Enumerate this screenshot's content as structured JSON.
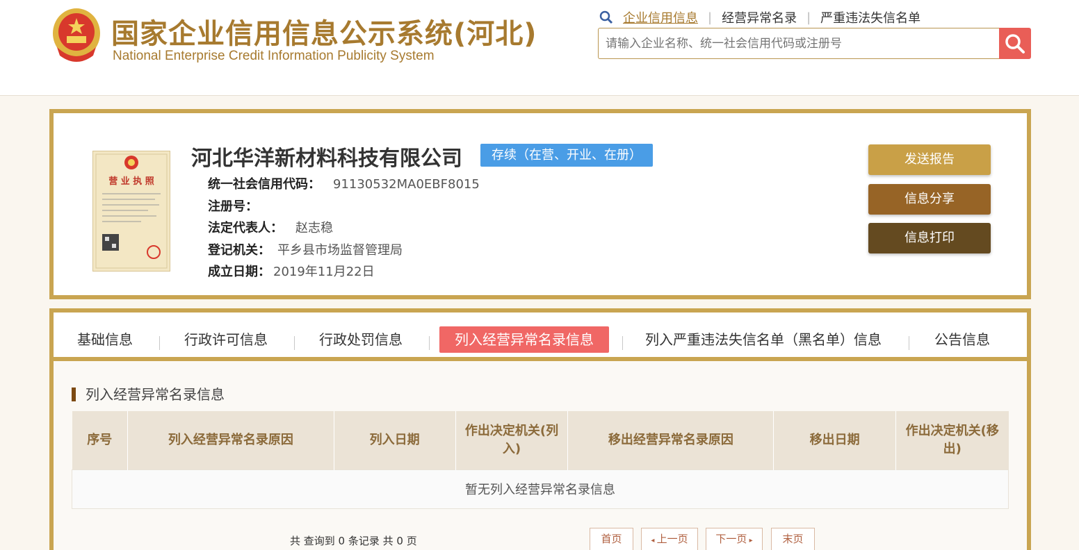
{
  "header": {
    "title_cn": "国家企业信用信息公示系统(河北)",
    "title_en": "National Enterprise Credit Information Publicity System",
    "links": [
      "企业信用信息",
      "经营异常名录",
      "严重违法失信名单"
    ],
    "search_placeholder": "请输入企业名称、统一社会信用代码或注册号"
  },
  "company": {
    "name": "河北华洋新材料科技有限公司",
    "status": "存续（在营、开业、在册）",
    "license_title": "营 业 执 照",
    "fields": [
      {
        "label": "统一社会信用代码：",
        "value": "91130532MA0EBF8015"
      },
      {
        "label": "注册号：",
        "value": ""
      },
      {
        "label": "法定代表人：",
        "value": "赵志稳"
      },
      {
        "label": "登记机关：",
        "value": "平乡县市场监督管理局"
      },
      {
        "label": "成立日期：",
        "value": "2019年11月22日"
      }
    ],
    "actions": [
      "发送报告",
      "信息分享",
      "信息打印"
    ]
  },
  "tabs": [
    "基础信息",
    "行政许可信息",
    "行政处罚信息",
    "列入经营异常名录信息",
    "列入严重违法失信名单（黑名单）信息",
    "公告信息"
  ],
  "section": {
    "title": "列入经营异常名录信息",
    "columns": [
      "序号",
      "列入经营异常名录原因",
      "列入日期",
      "作出决定机关(列入)",
      "移出经营异常名录原因",
      "移出日期",
      "作出决定机关(移出)"
    ],
    "empty_text": "暂无列入经营异常名录信息",
    "summary": "共 查询到 0 条记录 共 0 页",
    "pager": [
      "首页",
      "上一页",
      "下一页",
      "末页"
    ]
  },
  "colors": {
    "gold": "#c9a551",
    "brown": "#a77a2f",
    "active_tab": "#f06765",
    "status_blue": "#4a9de6",
    "search_red": "#e95e57"
  }
}
